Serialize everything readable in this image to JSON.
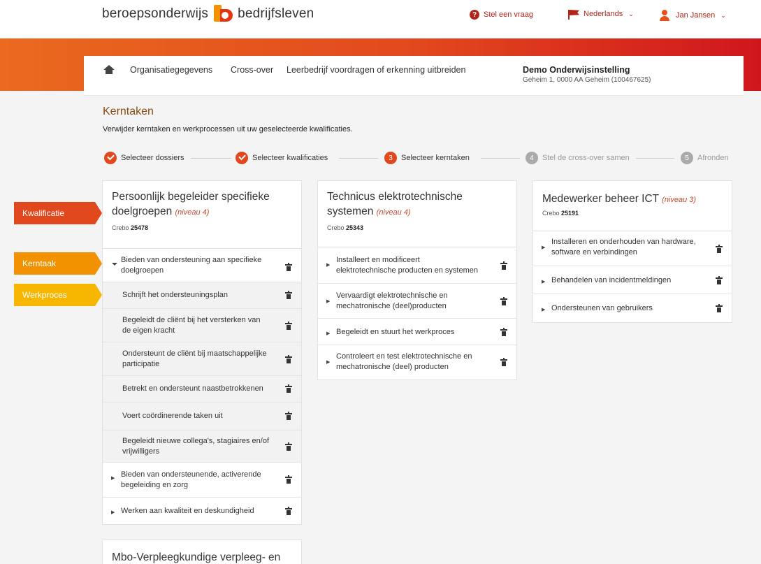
{
  "header": {
    "brand_left": "beroepsonderwijs",
    "brand_right": "bedrijfsleven",
    "help_link": "Stel een vraag",
    "language": "Nederlands",
    "user": "Jan Jansen"
  },
  "nav": {
    "links": [
      "Organisatiegegevens",
      "Cross-over",
      "Leerbedrijf voordragen of erkenning uitbreiden"
    ],
    "org_name": "Demo Onderwijsinstelling",
    "org_address": "Geheim 1, 0000 AA Geheim (100467625)"
  },
  "page": {
    "title": "Kerntaken",
    "subtitle": "Verwijder kerntaken en werkprocessen uit uw geselecteerde kwalificaties."
  },
  "steps": [
    {
      "label": "Selecteer dossiers",
      "state": "done",
      "num": "1"
    },
    {
      "label": "Selecteer kwalificaties",
      "state": "done",
      "num": "2"
    },
    {
      "label": "Selecteer kerntaken",
      "state": "active",
      "num": "3"
    },
    {
      "label": "Stel de cross-over samen",
      "state": "todo",
      "num": "4"
    },
    {
      "label": "Afronden",
      "state": "todo",
      "num": "5"
    }
  ],
  "tags": {
    "qualification": "Kwalificatie",
    "core_task": "Kerntaak",
    "work_process": "Werkproces"
  },
  "crebo_label": "Crebo",
  "columns": [
    {
      "title": "Persoonlijk begeleider specifieke doelgroepen",
      "title_lines": [
        "Persoonlijk begeleider specifieke",
        "doelgroepen"
      ],
      "level": "(niveau 4)",
      "crebo": "25478",
      "rows": [
        {
          "lines": [
            "Bieden van ondersteuning aan specifieke",
            "doelgroepen"
          ],
          "type": "core",
          "expanded": true
        },
        {
          "lines": [
            "Schrijft het ondersteuningsplan"
          ],
          "type": "wp"
        },
        {
          "lines": [
            "Begeleidt de cliënt bij het versterken van",
            "de eigen kracht"
          ],
          "type": "wp"
        },
        {
          "lines": [
            "Ondersteunt de cliënt bij maatschappelijke",
            "participatie"
          ],
          "type": "wp"
        },
        {
          "lines": [
            "Betrekt en ondersteunt naastbetrokkenen"
          ],
          "type": "wp"
        },
        {
          "lines": [
            "Voert coördinerende taken uit"
          ],
          "type": "wp"
        },
        {
          "lines": [
            "Begeleidt nieuwe collega's, stagiaires en/of",
            "vrijwilligers"
          ],
          "type": "wp"
        },
        {
          "lines": [
            "Bieden van ondersteunende, activerende",
            "begeleiding en zorg"
          ],
          "type": "core",
          "expanded": false
        },
        {
          "lines": [
            "Werken aan kwaliteit en deskundigheid"
          ],
          "type": "core",
          "expanded": false
        }
      ]
    },
    {
      "title": "Technicus elektrotechnische systemen",
      "title_lines": [
        "Technicus elektrotechnische",
        "systemen"
      ],
      "level": "(niveau 4)",
      "crebo": "25343",
      "rows": [
        {
          "lines": [
            "Installeert en modificeert",
            "elektrotechnische producten en systemen"
          ],
          "type": "core",
          "expanded": false
        },
        {
          "lines": [
            "Vervaardigt elektrotechnische en",
            "mechatronische (deel)producten"
          ],
          "type": "core",
          "expanded": false
        },
        {
          "lines": [
            "Begeleidt en stuurt het werkproces"
          ],
          "type": "core",
          "expanded": false
        },
        {
          "lines": [
            "Controleert en test elektrotechnische en",
            "mechatronische (deel) producten"
          ],
          "type": "core",
          "expanded": false
        }
      ]
    },
    {
      "title": "Medewerker beheer ICT",
      "title_lines": [
        "Medewerker beheer ICT"
      ],
      "level": "(niveau 3)",
      "crebo": "25191",
      "rows": [
        {
          "lines": [
            "Installeren en onderhouden van hardware,",
            "software en verbindingen"
          ],
          "type": "core",
          "expanded": false
        },
        {
          "lines": [
            "Behandelen van incidentmeldingen"
          ],
          "type": "core",
          "expanded": false
        },
        {
          "lines": [
            "Ondersteunen van gebruikers"
          ],
          "type": "core",
          "expanded": false
        }
      ]
    }
  ],
  "next_column_title": "Mbo-Verpleegkundige verpleeg- en"
}
